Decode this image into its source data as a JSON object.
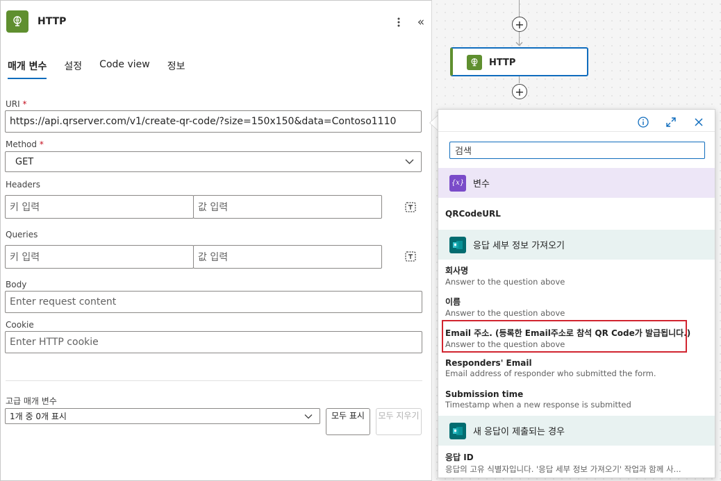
{
  "panel": {
    "title": "HTTP",
    "tabs": [
      {
        "label": "매개 변수",
        "active": true
      },
      {
        "label": "설정"
      },
      {
        "label": "Code view"
      },
      {
        "label": "정보"
      }
    ],
    "uri": {
      "label": "URI",
      "required_mark": "*",
      "value": "https://api.qrserver.com/v1/create-qr-code/?size=150x150&data=Contoso1110"
    },
    "method": {
      "label": "Method",
      "required_mark": "*",
      "value": "GET"
    },
    "headers": {
      "label": "Headers",
      "key_placeholder": "키 입력",
      "value_placeholder": "값 입력"
    },
    "queries": {
      "label": "Queries",
      "key_placeholder": "키 입력",
      "value_placeholder": "값 입력"
    },
    "body": {
      "label": "Body",
      "placeholder": "Enter request content"
    },
    "cookie": {
      "label": "Cookie",
      "placeholder": "Enter HTTP cookie"
    },
    "advanced": {
      "label": "고급 매개 변수",
      "select_value": "1개 중 0개 표시",
      "show_all": "모두 표시",
      "clear_all": "모두 지우기"
    }
  },
  "canvas": {
    "node_title": "HTTP"
  },
  "popup": {
    "search_placeholder": "검색",
    "sections": [
      {
        "label": "변수",
        "icon": "variable-icon",
        "color": "#7a4bc9",
        "items": [
          {
            "title": "QRCodeURL",
            "desc": ""
          }
        ]
      },
      {
        "label": "응답 세부 정보 가져오기",
        "icon": "forms-icon",
        "color": "#036c70",
        "items": [
          {
            "title": "회사명",
            "desc": "Answer to the question above"
          },
          {
            "title": "이름",
            "desc": "Answer to the question above"
          },
          {
            "title": "Email 주소. (등록한 Email주소로 참석 QR Code가 발급됩니다.)",
            "desc": "Answer to the question above",
            "highlighted": true
          },
          {
            "title": "Responders' Email",
            "desc": "Email address of responder who submitted the form."
          },
          {
            "title": "Submission time",
            "desc": "Timestamp when a new response is submitted"
          }
        ]
      },
      {
        "label": "새 응답이 제출되는 경우",
        "icon": "forms-icon",
        "color": "#036c70",
        "items": [
          {
            "title": "응답 ID",
            "desc": "응답의 고유 식별자입니다. '응답 세부 정보 가져오기' 작업과 함께 사..."
          }
        ]
      }
    ],
    "highlight_color": "#d1242f"
  }
}
